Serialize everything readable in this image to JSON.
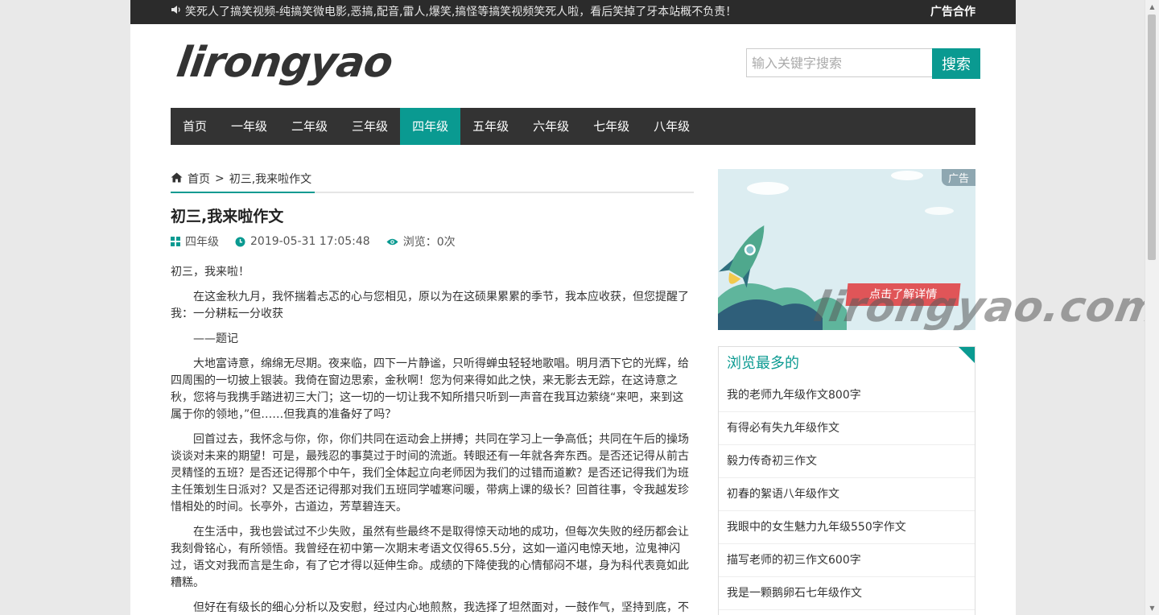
{
  "topbar": {
    "notice": "笑死人了搞笑视频-纯搞笑微电影,恶搞,配音,雷人,爆笑,搞怪等搞笑视频笑死人啦，看后笑掉了牙本站概不负责！",
    "ad_link": "广告合作"
  },
  "logo_text": "lirongyao",
  "search": {
    "placeholder": "输入关键字搜索",
    "button": "搜索"
  },
  "nav": {
    "items": [
      "首页",
      "一年级",
      "二年级",
      "三年级",
      "四年级",
      "五年级",
      "六年级",
      "七年级",
      "八年级"
    ],
    "active": "四年级"
  },
  "breadcrumb": {
    "home": "首页",
    "sep": ">",
    "current": "初三,我来啦作文"
  },
  "article": {
    "title": "初三,我来啦作文",
    "category": "四年级",
    "date": "2019-05-31 17:05:48",
    "views": "浏览：0次",
    "paragraphs": [
      "初三，我来啦！",
      "在这金秋九月，我怀揣着忐忑的心与您相见，原以为在这硕果累累的季节，我本应收获，但您提醒了我：一分耕耘一分收获",
      "——题记",
      "大地富诗意，绵绵无尽期。夜来临，四下一片静谧，只听得蝉虫轻轻地歌唱。明月洒下它的光辉，给四周围的一切披上银装。我倚在窗边思索，金秋啊！您为何来得如此之快，来无影去无踪，在这诗意之秋，您将与我携手踏进初三大门；这一切的一切让我不知所措只听到一声音在我耳边萦绕“来吧，来到这属于你的领地，”但……但我真的准备好了吗？",
      "回首过去，我怀念与你，你，你们共同在运动会上拼搏；共同在学习上一争高低；共同在午后的操场谈谈对未来的期望！可是，最残忍的事莫过于时间的流逝。转眼还有一年就各奔东西。是否还记得从前古灵精怪的五班？是否还记得那个中午，我们全体起立向老师因为我们的过错而道歉？是否还记得我们为班主任策划生日派对？又是否还记得那对我们五班同学嘘寒问暖，带病上课的级长？回首往事，令我越发珍惜相处的时间。长亭外，古道边，芳草碧连天。",
      "在生活中，我也尝试过不少失败，虽然有些最终不是取得惊天动地的成功，但每次失败的经历都会让我刻骨铭心，有所领悟。我曾经在初中第一次期末考语文仅得65.5分，这如一道闪电惊天地，泣鬼神闪过，语文对我而言是生命，有了它才得以延伸生命。成绩的下降使我的心情郁闷不堪，身为科代表竟如此糟糕。",
      "但好在有级长的细心分析以及安慰，经过内心地煎熬，我选择了坦然面对，一鼓作气，坚持到底，不"
    ]
  },
  "banner": {
    "ad_tag": "广告",
    "cta": "点击了解详情"
  },
  "watermark": "lirongyao.com",
  "sidebar": {
    "title": "浏览最多的",
    "items": [
      "我的老师九年级作文800字",
      "有得必有失九年级作文",
      "毅力传奇初三作文",
      "初春的絮语八年级作文",
      "我眼中的女生魅力九年级550字作文",
      "描写老师的初三作文600字",
      "我是一颗鹅卵石七年级作文"
    ]
  },
  "colors": {
    "accent": "#0a9a91",
    "dark": "#333333",
    "topbar": "#2b2b2b"
  }
}
